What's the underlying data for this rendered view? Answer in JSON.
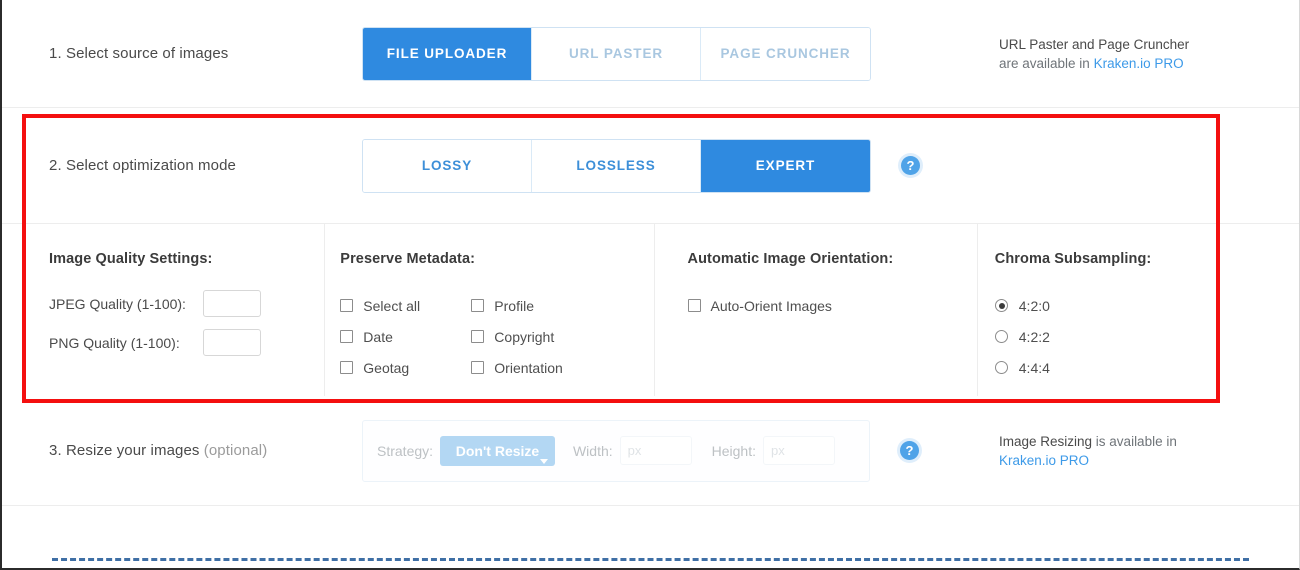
{
  "sections": {
    "source": {
      "label": "1. Select source of images",
      "tabs": [
        {
          "label": "FILE UPLOADER",
          "state": "active"
        },
        {
          "label": "URL PASTER",
          "state": "disabled"
        },
        {
          "label": "PAGE CRUNCHER",
          "state": "disabled"
        }
      ],
      "note_line1": "URL Paster and Page Cruncher",
      "note_line2_prefix": "are available in ",
      "note_link": "Kraken.io PRO"
    },
    "mode": {
      "label": "2. Select optimization mode",
      "tabs": [
        {
          "label": "LOSSY",
          "state": "enabled"
        },
        {
          "label": "LOSSLESS",
          "state": "enabled"
        },
        {
          "label": "EXPERT",
          "state": "active"
        }
      ],
      "help_glyph": "?"
    },
    "resize": {
      "label_main": "3. Resize your images ",
      "label_optional": "(optional)",
      "strategy_label": "Strategy:",
      "strategy_value": "Don't Resize",
      "width_label": "Width:",
      "width_value": "",
      "width_placeholder": "px",
      "height_label": "Height:",
      "height_value": "",
      "height_placeholder": "px",
      "help_glyph": "?",
      "note_strong": "Image Resizing",
      "note_rest": " is available in",
      "note_link": "Kraken.io PRO"
    }
  },
  "expert_panels": {
    "quality": {
      "title": "Image Quality Settings:",
      "fields": [
        {
          "label": "JPEG Quality (1-100):",
          "value": "",
          "placeholder": ""
        },
        {
          "label": "PNG Quality (1-100):",
          "value": "",
          "placeholder": ""
        }
      ]
    },
    "metadata": {
      "title": "Preserve Metadata:",
      "column_left": [
        {
          "label": "Select all",
          "checked": false
        },
        {
          "label": "Date",
          "checked": false
        },
        {
          "label": "Geotag",
          "checked": false
        }
      ],
      "column_right": [
        {
          "label": "Profile",
          "checked": false
        },
        {
          "label": "Copyright",
          "checked": false
        },
        {
          "label": "Orientation",
          "checked": false
        }
      ]
    },
    "orientation": {
      "title": "Automatic Image Orientation:",
      "options": [
        {
          "label": "Auto-Orient Images",
          "checked": false
        }
      ]
    },
    "chroma": {
      "title": "Chroma Subsampling:",
      "options": [
        {
          "label": "4:2:0",
          "selected": true
        },
        {
          "label": "4:2:2",
          "selected": false
        },
        {
          "label": "4:4:4",
          "selected": false
        }
      ]
    }
  },
  "colors": {
    "accent_blue": "#2f8ae0",
    "link_blue": "#3d9ae8",
    "highlight_red": "#f40f0f",
    "muted_tab": "#a9c7e0"
  }
}
